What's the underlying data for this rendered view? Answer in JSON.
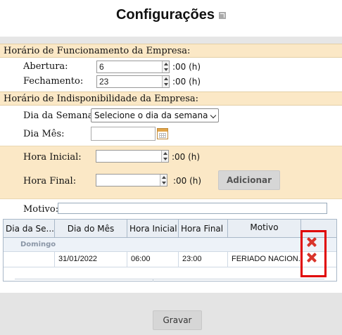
{
  "page": {
    "title": "Configurações",
    "title_icon": "external-link-icon"
  },
  "business_hours": {
    "section_label": "Horário de Funcionamento da Empresa:",
    "opening": {
      "label": "Abertura:",
      "value": "6",
      "unit": ":00 (h)"
    },
    "closing": {
      "label": "Fechamento:",
      "value": "23",
      "unit": ":00 (h)"
    }
  },
  "unavailability": {
    "section_label": "Horário de Indisponibilidade da Empresa:",
    "weekday": {
      "label": "Dia da Semana:",
      "selected": "Selecione o dia da semana"
    },
    "month_day": {
      "label": "Dia Mês:",
      "value": "",
      "icon": "calendar-icon"
    },
    "start_time": {
      "label": "Hora Inicial:",
      "value": "",
      "unit": ":00 (h)"
    },
    "end_time": {
      "label": "Hora Final:",
      "value": "",
      "unit": ":00 (h)"
    },
    "add_button": "Adicionar",
    "reason": {
      "label": "Motivo:",
      "value": ""
    }
  },
  "grid": {
    "columns": [
      "Dia da Se...",
      "Dia do Mês",
      "Hora Inicial",
      "Hora Final",
      "Motivo"
    ],
    "groups": [
      {
        "label": "Domingo"
      }
    ],
    "rows": [
      {
        "weekday": "",
        "date": "31/01/2022",
        "start": "06:00",
        "end": "23:00",
        "reason": "FERIADO NACION..."
      }
    ],
    "delete_icon": "delete-x-icon",
    "highlight_color": "#e00000"
  },
  "save_button": "Gravar",
  "colors": {
    "section_bg": "#fbe8c6",
    "grid_header_bg": "#e9eef4",
    "delete_red": "#d9342b"
  }
}
